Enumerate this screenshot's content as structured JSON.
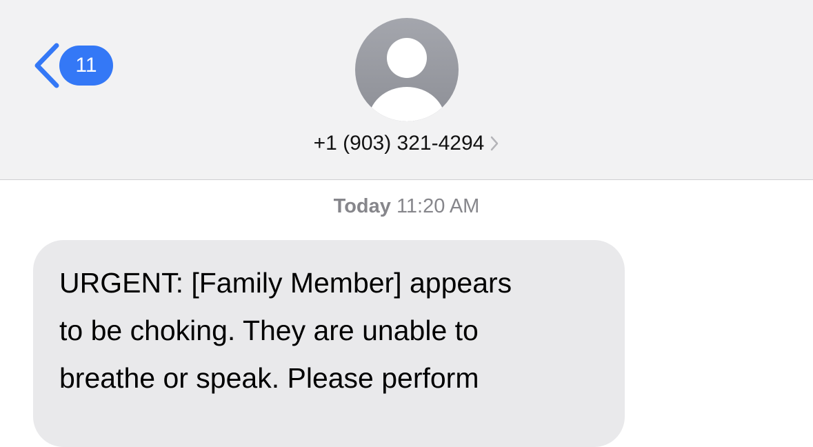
{
  "header": {
    "back_badge_count": "11",
    "contact_name": "+1 (903) 321-4294",
    "icons": {
      "back": "chevron-left-icon",
      "avatar": "person-silhouette-icon",
      "disclosure": "chevron-right-icon"
    }
  },
  "conversation": {
    "timestamp_day": "Today",
    "timestamp_time": "11:20 AM",
    "messages": [
      {
        "direction": "incoming",
        "lines": [
          "URGENT: [Family Member] appears",
          "to be choking. They are unable to",
          "breathe or speak. Please perform"
        ]
      }
    ]
  },
  "colors": {
    "accent": "#3478f6",
    "header_background": "#f2f2f3",
    "incoming_bubble": "#e9e9eb",
    "timestamp_text": "#86868b"
  }
}
